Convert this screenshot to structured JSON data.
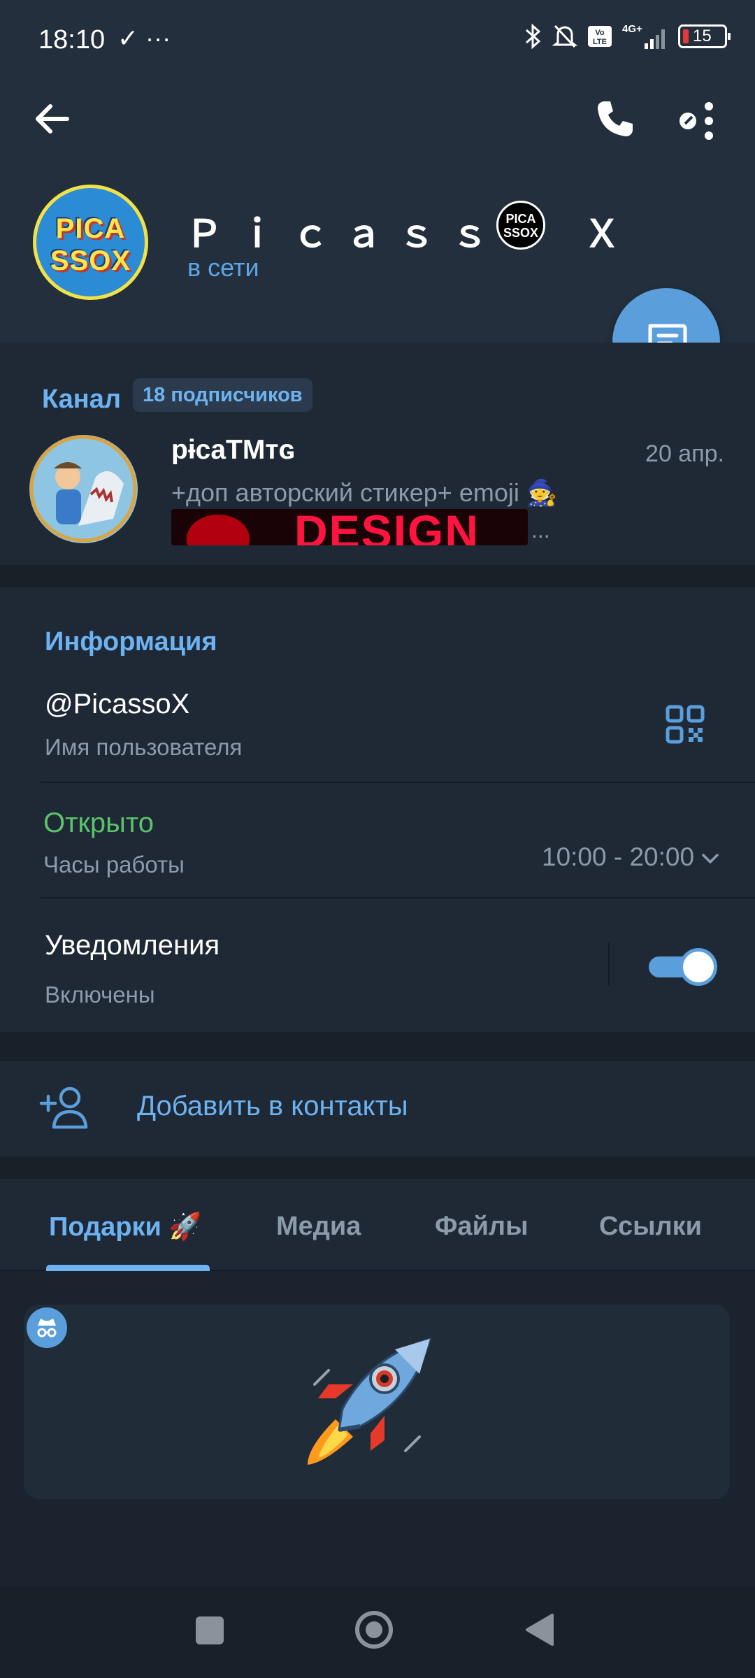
{
  "status_bar": {
    "time": "18:10",
    "left_icons": "✓ ···",
    "network": "4G+",
    "volte": "Vo LTE",
    "battery": "15"
  },
  "header": {
    "name": "Ｐｉｃａｓｓｏ Ｘ",
    "name_badge_line1": "PICA",
    "name_badge_line2": "SSOX",
    "avatar_line1": "PICA",
    "avatar_line2": "SSOX",
    "status": "в сети",
    "icons": [
      "back-arrow-icon",
      "phone-icon",
      "more-icon",
      "message-icon"
    ]
  },
  "channel": {
    "label": "Канал",
    "subscribers": "18 подписчиков",
    "title": "pɨcaTMтɢ",
    "date": "20 апр.",
    "preview": "+доп авторский стикер+ emoji 🧙",
    "image_text": "DESIGN",
    "ellipsis": "..."
  },
  "info": {
    "heading": "Информация",
    "username": "@PicassoX",
    "username_label": "Имя пользователя",
    "hours_status": "Открыто",
    "hours_label": "Часы работы",
    "hours_value": "10:00 - 20:00",
    "notifications_title": "Уведомления",
    "notifications_status": "Включены",
    "notifications_on": true
  },
  "actions": {
    "add_contact": "Добавить в контакты"
  },
  "tabs": [
    {
      "label": "Подарки 🚀",
      "active": true
    },
    {
      "label": "Медиа",
      "active": false
    },
    {
      "label": "Файлы",
      "active": false
    },
    {
      "label": "Ссылки",
      "active": false
    }
  ],
  "gifts": {
    "items": [
      {
        "emoji": "🚀"
      }
    ]
  },
  "colors": {
    "accent": "#6db3f2",
    "fab": "#5a9fdc",
    "online_green": "#59c36a",
    "background": "#1d2733"
  }
}
